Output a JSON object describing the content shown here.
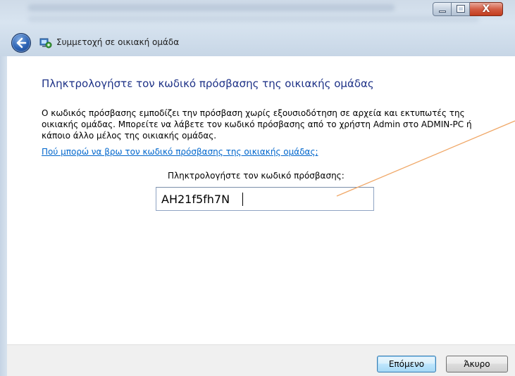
{
  "window": {
    "close_glyph": "X"
  },
  "nav": {
    "title": "Συμμετοχή σε οικιακή ομάδα",
    "back_icon": "back-arrow-icon",
    "homegroup_icon": "homegroup-icon"
  },
  "main": {
    "heading": "Πληκτρολογήστε τον κωδικό πρόσβασης της οικιακής ομάδας",
    "description": "Ο κωδικός πρόσβασης εμποδίζει την πρόσβαση χωρίς εξουσιοδότηση σε αρχεία και εκτυπωτές της οικιακής ομάδας. Μπορείτε να λάβετε τον κωδικό πρόσβασης από το χρήστη Admin στο ADMIN-PC ή κάποιο άλλο μέλος της οικιακής ομάδας.",
    "help_link": "Πού μπορώ να βρω τον κωδικό πρόσβασης της οικιακής ομάδας;",
    "password_label": "Πληκτρολογήστε τον κωδικό πρόσβασης:",
    "password_value": "AH21f5fh7N"
  },
  "footer": {
    "next_label": "Επόμενο",
    "cancel_label": "Άκυρο"
  },
  "colors": {
    "heading": "#1e3287",
    "link": "#0066cc",
    "annotation_line": "#f0a868"
  }
}
